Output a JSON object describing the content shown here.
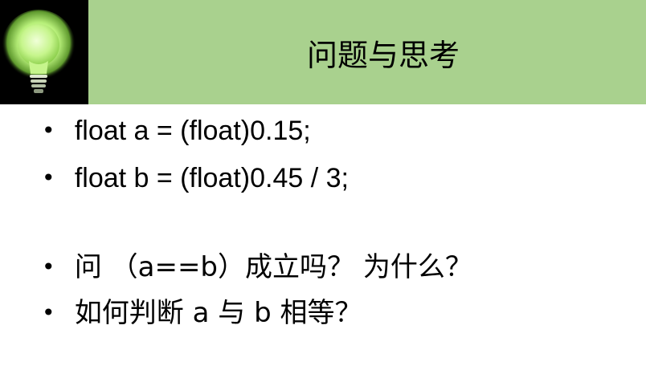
{
  "slide": {
    "title": "问题与思考",
    "bullets": [
      {
        "dot": "•",
        "text": "float  a = (float)0.15;"
      },
      {
        "dot": "•",
        "text": "float  b = (float)0.45 / 3;"
      },
      {
        "dot": "•",
        "text": "问 （a==b）成立吗？ 为什么？"
      },
      {
        "dot": "•",
        "text": "如何判断 a 与 b 相等？"
      }
    ]
  },
  "colors": {
    "header_bg": "#a9d18e",
    "logo_bg": "#000000",
    "bulb_glow": "#b8f07a"
  },
  "icons": {
    "logo": "lightbulb-icon"
  }
}
